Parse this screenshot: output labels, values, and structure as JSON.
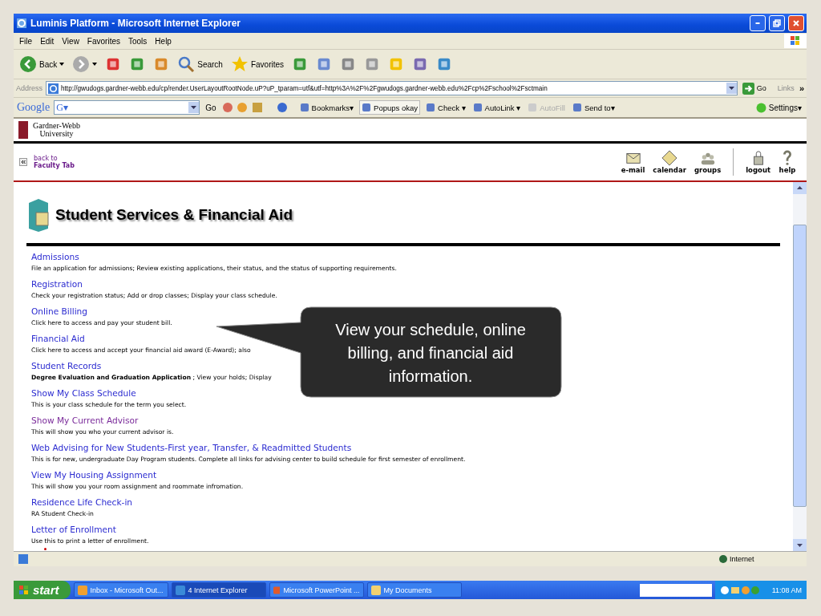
{
  "window": {
    "title": "Luminis Platform - Microsoft Internet Explorer"
  },
  "menu": [
    "File",
    "Edit",
    "View",
    "Favorites",
    "Tools",
    "Help"
  ],
  "toolbar": [
    {
      "kind": "back",
      "label": "Back"
    },
    {
      "kind": "forward"
    },
    {
      "kind": "stop"
    },
    {
      "kind": "refresh"
    },
    {
      "kind": "home"
    },
    {
      "kind": "search",
      "label": "Search"
    },
    {
      "kind": "favorites",
      "label": "Favorites"
    },
    {
      "kind": "history"
    },
    {
      "kind": "mail"
    },
    {
      "kind": "print"
    },
    {
      "kind": "edit"
    },
    {
      "kind": "notes"
    },
    {
      "kind": "research"
    },
    {
      "kind": "messenger"
    }
  ],
  "address": {
    "label": "Address",
    "value": "http://gwudogs.gardner-webb.edu/cp/render.UserLayoutRootNode.uP?uP_tparam=utf&utf=http%3A%2F%2Fgwudogs.gardner-webb.edu%2Fcp%2Fschool%2Fsctmain",
    "go": "Go",
    "links": "Links",
    "more": "»"
  },
  "google_bar": {
    "logo": "Google",
    "g_menu": "G▾",
    "go": "Go",
    "items": [
      {
        "label": "Bookmarks▾",
        "disabled": false
      },
      {
        "label": "Popups okay",
        "disabled": false
      },
      {
        "label": "Check ▾",
        "disabled": false
      },
      {
        "label": "AutoLink ▾",
        "disabled": false
      },
      {
        "label": "AutoFill",
        "disabled": true
      },
      {
        "label": "Send to▾",
        "disabled": false
      }
    ],
    "settings": "Settings▾"
  },
  "site": {
    "logo_line1": "Gardner-Webb",
    "logo_line2": "University",
    "back_label": "back to",
    "back_target": "Faculty Tab",
    "nav": [
      {
        "kind": "mail",
        "label": "e-mail"
      },
      {
        "kind": "calendar",
        "label": "calendar"
      },
      {
        "kind": "groups",
        "label": "groups"
      },
      {
        "kind": "logout",
        "label": "logout"
      },
      {
        "kind": "help",
        "label": "help"
      }
    ]
  },
  "channel": {
    "title": "Student Services & Financial Aid",
    "links": [
      {
        "label": "Admissions",
        "visited": false,
        "description": "File an application for admissions; Review existing applications, their status, and the status of supporting requirements."
      },
      {
        "label": "Registration",
        "visited": false,
        "description": "Check your registration status; Add or drop classes; Display your class schedule."
      },
      {
        "label": "Online Billing",
        "visited": false,
        "description": "Click here to access and pay your student bill."
      },
      {
        "label": "Financial Aid",
        "visited": false,
        "description": "Click here to access and accept your financial aid award (E-Award); also"
      },
      {
        "label": "Student Records",
        "visited": false,
        "description": "**Degree Evaluation and Graduation Application** ; View your holds; Display "
      },
      {
        "label": "Show My Class Schedule",
        "visited": false,
        "description": "This is your class schedule for the term you select."
      },
      {
        "label": "Show My Current Advisor",
        "visited": true,
        "description": "This will show you who your current advisor is."
      },
      {
        "label": "Web Advising for New Students-First year, Transfer, & Readmitted Students",
        "visited": false,
        "description": "This is for new, undergraduate Day Program students. Complete all links for advising center to build schedule for first semester of enrollment."
      },
      {
        "label": "View My Housing Assignment",
        "visited": false,
        "description": "This will show you your room assignment and roommate infromation."
      },
      {
        "label": "Residence Life Check-in",
        "visited": false,
        "description": "RA Student Check-in"
      },
      {
        "label": "Letter of Enrollment",
        "visited": false,
        "description": "Use this to print a letter of enrollment."
      }
    ]
  },
  "status_bar": {
    "zone": "Internet"
  },
  "taskbar": {
    "start": "start",
    "tasks": [
      {
        "kind": "outlook",
        "label": "Inbox - Microsoft Out...",
        "selected": false
      },
      {
        "kind": "ie",
        "label": "4 Internet Explorer",
        "selected": true
      },
      {
        "kind": "powerpoint",
        "label": "Microsoft PowerPoint ...",
        "selected": false
      },
      {
        "kind": "folder",
        "label": "My Documents",
        "selected": false
      }
    ],
    "clock": "11:08 AM"
  },
  "callout": {
    "text": "View your schedule, online billing, and financial aid information."
  }
}
